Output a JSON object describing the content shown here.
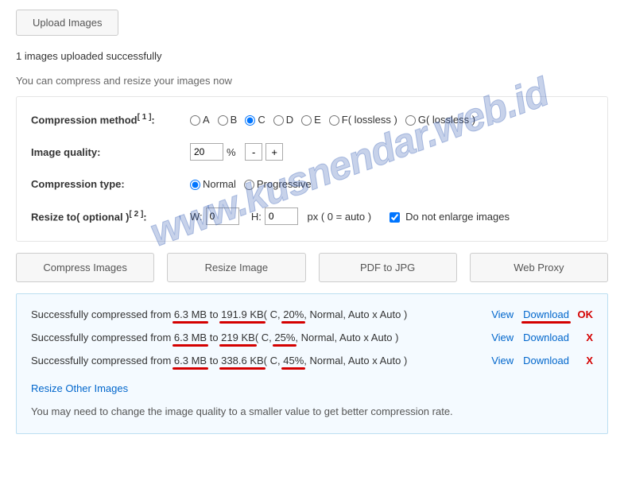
{
  "upload": {
    "button_label": "Upload Images",
    "status": "1 images uploaded successfully",
    "hint": "You can compress and resize your images now"
  },
  "form": {
    "compression_method": {
      "label": "Compression method",
      "sup": "[ 1 ]",
      "options": [
        "A",
        "B",
        "C",
        "D",
        "E",
        "F( lossless )",
        "G( lossless )"
      ],
      "selected": "C"
    },
    "image_quality": {
      "label": "Image quality:",
      "value": "20",
      "unit": "%"
    },
    "compression_type": {
      "label": "Compression type:",
      "options": [
        "Normal",
        "Progressive"
      ],
      "selected": "Normal"
    },
    "resize": {
      "label": "Resize to( optional )",
      "sup": "[ 2 ]",
      "w_label": "W:",
      "w_value": "0",
      "h_label": "H:",
      "h_value": "0",
      "px_hint": "px ( 0 = auto )",
      "enlarge_checked": true,
      "enlarge_label": "Do not enlarge images"
    }
  },
  "action_buttons": {
    "compress": "Compress Images",
    "resize": "Resize Image",
    "pdf2jpg": "PDF to JPG",
    "webproxy": "Web Proxy"
  },
  "results": {
    "rows": [
      {
        "prefix": "Successfully compressed from ",
        "from": "6.3 MB",
        "to_word": " to ",
        "to": "191.9 KB",
        "params_open": "( C, ",
        "pct": "20%",
        "params_close": ", Normal, Auto x Auto )",
        "view": "View",
        "download": "Download",
        "annot": "OK",
        "annot_class": "ok",
        "dl_underline": true
      },
      {
        "prefix": "Successfully compressed from ",
        "from": "6.3 MB",
        "to_word": " to ",
        "to": "219 KB",
        "params_open": "( C, ",
        "pct": "25%",
        "params_close": ", Normal, Auto x Auto )",
        "view": "View",
        "download": "Download",
        "annot": "X",
        "annot_class": "x",
        "dl_underline": false
      },
      {
        "prefix": "Successfully compressed from ",
        "from": "6.3 MB",
        "to_word": " to ",
        "to": "338.6 KB",
        "params_open": "( C, ",
        "pct": "45%",
        "params_close": ", Normal, Auto x Auto )",
        "view": "View",
        "download": "Download",
        "annot": "X",
        "annot_class": "x",
        "dl_underline": false
      }
    ],
    "resize_other": "Resize Other Images",
    "footer": "You may need to change the image quality to a smaller value to get better compression rate."
  },
  "watermark": "www.kusnendar.web.id"
}
